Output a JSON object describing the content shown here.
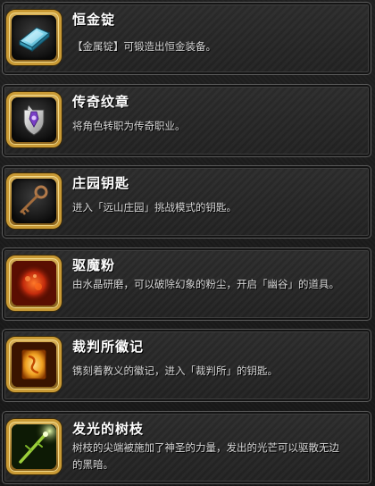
{
  "items": [
    {
      "title": "恒金锭",
      "description": "【金属锭】可锻造出恒金装备。",
      "icon": "ingot-icon"
    },
    {
      "title": "传奇纹章",
      "description": "将角色转职为传奇职业。",
      "icon": "crest-icon"
    },
    {
      "title": "庄园钥匙",
      "description": "进入「远山庄园」挑战模式的钥匙。",
      "icon": "key-icon"
    },
    {
      "title": "驱魔粉",
      "description": "由水晶研磨，可以破除幻象的粉尘，开启「幽谷」的道具。",
      "icon": "powder-icon"
    },
    {
      "title": "裁判所徽记",
      "description": "镌刻着教义的徽记，进入「裁判所」的钥匙。",
      "icon": "emblem-icon"
    },
    {
      "title": "发光的树枝",
      "description": "树枝的尖端被施加了神圣的力量，发出的光芒可以驱散无边的黑暗。",
      "icon": "glowing-branch-icon"
    }
  ],
  "colors": {
    "frame_gold": "#c99a35",
    "title_text": "#ffffff",
    "desc_text": "#d8d8d8"
  }
}
